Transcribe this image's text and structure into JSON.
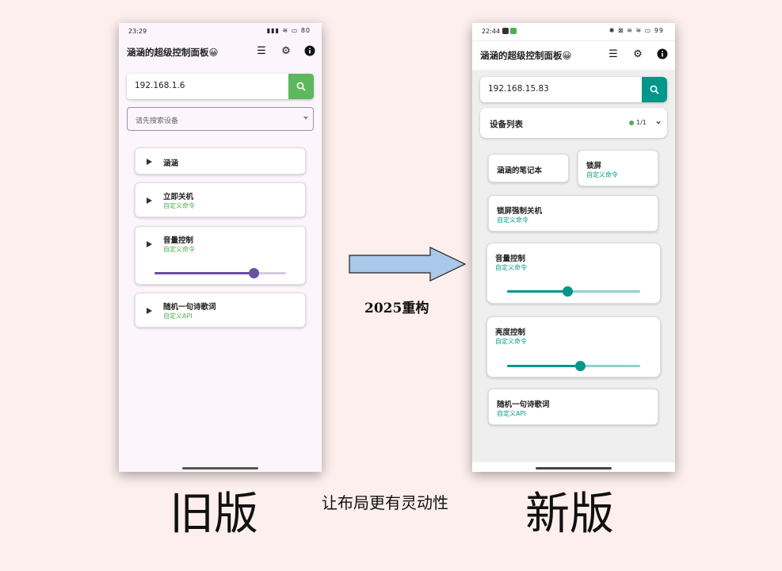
{
  "old_app": {
    "status_time": "23:29",
    "status_icons": "▮▮▮ ≋ ▭",
    "battery": "80",
    "title": "涵涵的超级控制面板😀",
    "ip_value": "192.168.1.6",
    "device_select_placeholder": "请先搜索设备",
    "cards": [
      {
        "title": "涵涵",
        "subtitle": ""
      },
      {
        "title": "立即关机",
        "subtitle": "自定义命令"
      },
      {
        "title": "音量控制",
        "subtitle": "自定义命令",
        "slider_value": 0.75
      },
      {
        "title": "随机一句诗歌词",
        "subtitle": "自定义API"
      }
    ]
  },
  "new_app": {
    "status_time": "22:44",
    "status_icons": "✱ ⊠ ≋ ≋ ▭",
    "battery": "99",
    "title": "涵涵的超级控制面板😀",
    "ip_value": "192.168.15.83",
    "device_list_label": "设备列表",
    "device_count": "1/1",
    "cards": [
      {
        "title": "涵涵的笔记本",
        "subtitle": ""
      },
      {
        "title": "锁屏",
        "subtitle": "自定义命令"
      },
      {
        "title": "锁屏强制关机",
        "subtitle": "自定义命令"
      },
      {
        "title": "音量控制",
        "subtitle": "自定义命令",
        "slider_value": 0.45
      },
      {
        "title": "亮度控制",
        "subtitle": "自定义命令",
        "slider_value": 0.55
      },
      {
        "title": "随机一句诗歌词",
        "subtitle": "自定义API"
      }
    ]
  },
  "annotations": {
    "arrow_label": "2025重构",
    "old_label": "旧版",
    "new_label": "新版",
    "middle_caption": "让布局更有灵动性"
  },
  "colors": {
    "old_accent": "#6b4fa0",
    "old_search": "#5cb85c",
    "old_sub": "#4caf50",
    "new_accent": "#00968a",
    "new_sub": "#0a9a88",
    "arrow_fill": "#a9c8ea"
  },
  "icons": [
    "list-icon",
    "settings-gear-icon",
    "info-icon",
    "search-icon",
    "play-arrow-icon",
    "dropdown-arrow-icon",
    "chevron-down-icon"
  ]
}
